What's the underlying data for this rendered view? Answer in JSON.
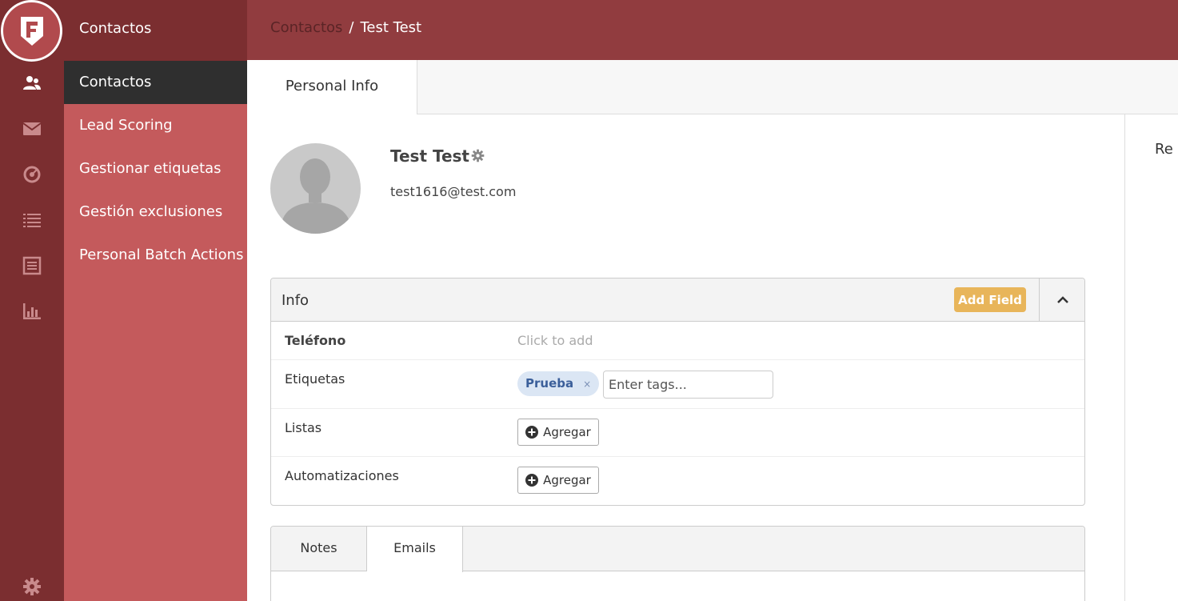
{
  "submenu": {
    "header": "Contactos",
    "items": [
      {
        "label": "Contactos",
        "active": true
      },
      {
        "label": "Lead Scoring",
        "active": false
      },
      {
        "label": "Gestionar etiquetas",
        "active": false
      },
      {
        "label": "Gestión exclusiones",
        "active": false
      },
      {
        "label": "Personal Batch Actions",
        "active": false
      }
    ]
  },
  "rail": {
    "icons": [
      "contacts-icon",
      "mail-icon",
      "dashboard-icon",
      "list-icon",
      "form-icon",
      "chart-icon",
      "gear-icon"
    ]
  },
  "breadcrumb": {
    "parent": "Contactos",
    "separator": "/",
    "current": "Test Test"
  },
  "tabs": {
    "personal_info": "Personal Info"
  },
  "right_panel": {
    "label_partial": "Re"
  },
  "contact": {
    "name": "Test Test",
    "email": "test1616@test.com"
  },
  "info_panel": {
    "title": "Info",
    "add_field": "Add Field",
    "rows": {
      "phone_label": "Teléfono",
      "phone_placeholder": "Click to add",
      "tags_label": "Etiquetas",
      "tag_value": "Prueba",
      "tag_remove": "×",
      "tags_input_placeholder": "Enter tags...",
      "lists_label": "Listas",
      "lists_button": "Agregar",
      "automations_label": "Automatizaciones",
      "automations_button": "Agregar"
    }
  },
  "notes_panel": {
    "tab_notes": "Notes",
    "tab_emails": "Emails"
  },
  "colors": {
    "rail": "#7b2e30",
    "submenu": "#c45a5c",
    "topbar": "#913c3f",
    "active_item": "#2f2f2f",
    "add_field": "#e8b55a"
  }
}
